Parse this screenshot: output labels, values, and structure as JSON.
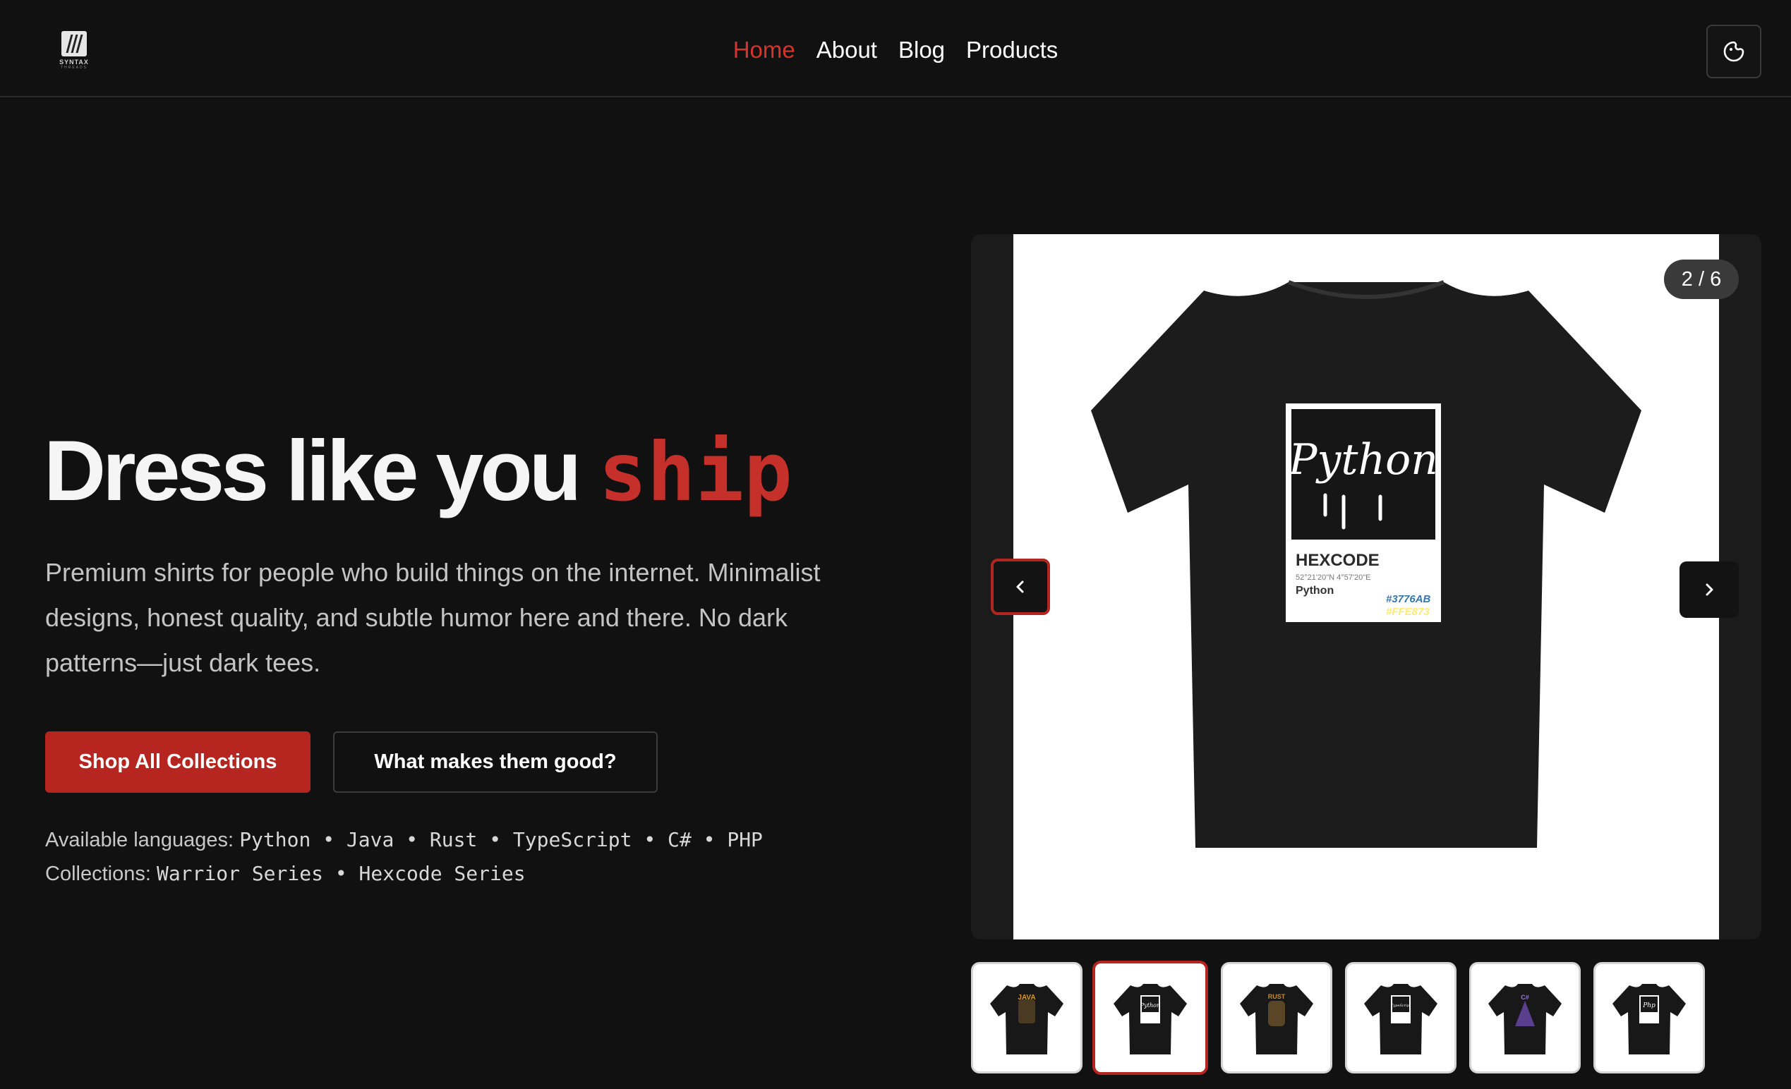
{
  "brand": {
    "name": "SYNTAX",
    "sub": "THREADS"
  },
  "nav": {
    "home": "Home",
    "about": "About",
    "blog": "Blog",
    "products": "Products"
  },
  "hero": {
    "title_main": "Dress like you ",
    "title_accent": "ship",
    "description": "Premium shirts for people who build things on the internet. Minimalist designs, honest quality, and subtle humor here and there. No dark patterns—just dark tees.",
    "cta_primary": "Shop All Collections",
    "cta_secondary": "What makes them good?",
    "languages_label": "Available languages:",
    "languages": "Python • Java • Rust • TypeScript • C# • PHP",
    "collections_label": "Collections:",
    "collections": "Warrior Series • Hexcode Series"
  },
  "carousel": {
    "counter": "2 / 6",
    "current": {
      "print_title": "Python",
      "label": "HEXCODE",
      "coords": "52°21'20\"N 4°57'20\"E",
      "lang": "Python",
      "hex1": "#3776AB",
      "hex2": "#FFE873"
    },
    "thumbnails": [
      {
        "name": "java",
        "label": "JAVA"
      },
      {
        "name": "python",
        "label": "Python"
      },
      {
        "name": "rust",
        "label": "RUST"
      },
      {
        "name": "typescript",
        "label": "TypeScript"
      },
      {
        "name": "csharp",
        "label": "C#"
      },
      {
        "name": "php",
        "label": "Php"
      }
    ]
  },
  "colors": {
    "accent": "#c6302a",
    "background": "#111111",
    "button": "#b6251f"
  }
}
